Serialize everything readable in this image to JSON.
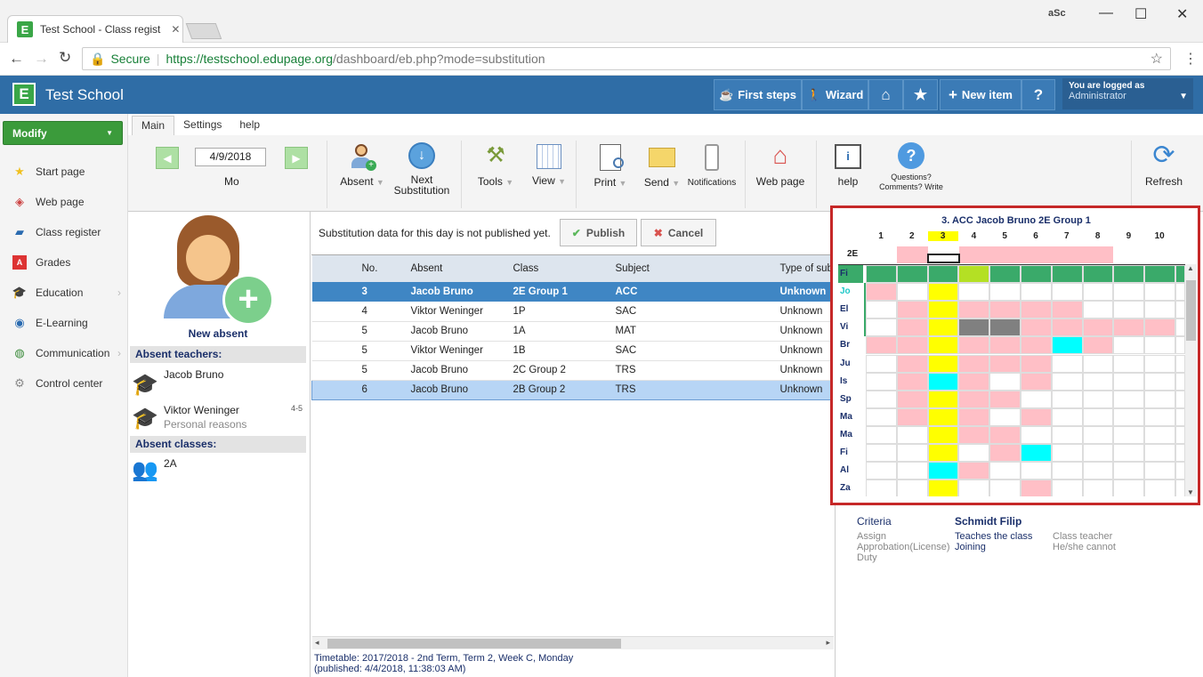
{
  "browser": {
    "tab_title": "Test School - Class regist",
    "secure_label": "Secure",
    "url_base": "https://testschool.edupage.org",
    "url_path": "/dashboard/eb.php?mode=substitution",
    "corner_label": "aSc"
  },
  "header": {
    "logo_letter": "E",
    "school_name": "Test School",
    "first_steps": "First steps",
    "wizard": "Wizard",
    "new_item": "New item",
    "help_q": "?",
    "logged_in_label": "You are logged as",
    "user": "Administrator"
  },
  "sidebar": {
    "modify": "Modify",
    "items": [
      {
        "label": "Start page",
        "icon": "star-icon"
      },
      {
        "label": "Web page",
        "icon": "web-icon"
      },
      {
        "label": "Class register",
        "icon": "book-icon"
      },
      {
        "label": "Grades",
        "icon": "grades-icon"
      },
      {
        "label": "Education",
        "icon": "education-icon"
      },
      {
        "label": "E-Learning",
        "icon": "elearning-icon"
      },
      {
        "label": "Communication",
        "icon": "communication-icon"
      },
      {
        "label": "Control center",
        "icon": "gear-icon"
      }
    ]
  },
  "ribbon": {
    "tabs": [
      "Main",
      "Settings",
      "help"
    ],
    "date": "4/9/2018",
    "day": "Mo",
    "absent": "Absent",
    "next_line1": "Next",
    "next_line2": "Substitution",
    "tools": "Tools",
    "view": "View",
    "print": "Print",
    "send": "Send",
    "notifications": "Notifications",
    "web_page": "Web page",
    "help": "help",
    "questions": "Questions? Comments? Write us.",
    "refresh": "Refresh"
  },
  "left_panel": {
    "new_absent": "New absent",
    "absent_teachers_title": "Absent teachers:",
    "teachers": [
      {
        "name": "Jacob Bruno",
        "note": "",
        "periods": ""
      },
      {
        "name": "Viktor Weninger",
        "note": "Personal reasons",
        "periods": "4-5"
      }
    ],
    "absent_classes_title": "Absent classes:",
    "classes": [
      "2A"
    ]
  },
  "main": {
    "notice": "Substitution data for this day is not published yet.",
    "publish": "Publish",
    "cancel": "Cancel",
    "columns": [
      "No.",
      "Absent",
      "Class",
      "Subject",
      "Type of sub"
    ],
    "rows": [
      {
        "no": "3",
        "absent": "Jacob Bruno",
        "class": "2E Group 1",
        "subject": "ACC",
        "type": "Unknown",
        "state": "selected"
      },
      {
        "no": "4",
        "absent": "Viktor Weninger",
        "class": "1P",
        "subject": "SAC",
        "type": "Unknown",
        "state": ""
      },
      {
        "no": "5",
        "absent": "Jacob Bruno",
        "class": "1A",
        "subject": "MAT",
        "type": "Unknown",
        "state": ""
      },
      {
        "no": "5",
        "absent": "Viktor Weninger",
        "class": "1B",
        "subject": "SAC",
        "type": "Unknown",
        "state": ""
      },
      {
        "no": "5",
        "absent": "Jacob Bruno",
        "class": "2C Group 2",
        "subject": "TRS",
        "type": "Unknown",
        "state": ""
      },
      {
        "no": "6",
        "absent": "Jacob Bruno",
        "class": "2B Group 2",
        "subject": "TRS",
        "type": "Unknown",
        "state": "highlight"
      }
    ],
    "footer1": "Timetable: 2017/2018 - 2nd Term, Term 2, Week C, Monday",
    "footer2": "(published: 4/4/2018, 11:38:03 AM)"
  },
  "timetable": {
    "title": "3. ACC Jacob Bruno 2E Group 1",
    "class_label": "2E",
    "periods": [
      "1",
      "2",
      "3",
      "4",
      "5",
      "6",
      "7",
      "8",
      "9",
      "10"
    ],
    "rows": [
      {
        "label": "Fi",
        "cells": "gggGgggggg"
      },
      {
        "label": "Jo",
        "cells": "p.Y......."
      },
      {
        "label": "El",
        "cells": ".pYpppp..."
      },
      {
        "label": "Vi",
        "cells": ".pYddppppp"
      },
      {
        "label": "Br",
        "cells": "ppYpppcp.."
      },
      {
        "label": "Ju",
        "cells": ".pYppp...."
      },
      {
        "label": "Is",
        "cells": ".pCp.p...."
      },
      {
        "label": "Sp",
        "cells": ".pYpp....."
      },
      {
        "label": "Ma",
        "cells": ".pYp.p...."
      },
      {
        "label": "Ma",
        "cells": "..Ypp....."
      },
      {
        "label": "Fi",
        "cells": "..Y.pc...."
      },
      {
        "label": "Al",
        "cells": "..Cp......"
      },
      {
        "label": "Za",
        "cells": "..Y..p...."
      }
    ],
    "colors": {
      "g": "#3aaa6a",
      "G": "#b4e024",
      "p": "#ffbfc6",
      "Y": "#ffff00",
      "C": "#00ffff",
      "c": "#00ffff",
      "d": "#808080",
      ".": "#ffffff"
    }
  },
  "criteria": {
    "col1_title": "Criteria",
    "col1": [
      "Assign",
      "Approbation(License)",
      "Duty"
    ],
    "col2_title": "Schmidt Filip",
    "col2": [
      "Teaches the class",
      "Joining"
    ],
    "col3": [
      "Class teacher",
      "He/she cannot"
    ]
  }
}
